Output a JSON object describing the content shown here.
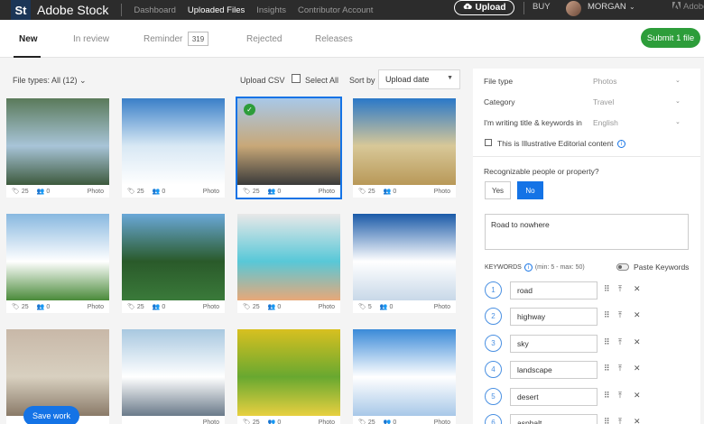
{
  "topbar": {
    "logo": "St",
    "brand": "Adobe Stock",
    "nav": [
      "Dashboard",
      "Uploaded Files",
      "Insights",
      "Contributor Account"
    ],
    "active_nav": "Uploaded Files",
    "upload_label": "Upload",
    "buy_label": "BUY",
    "username": "MORGAN",
    "adobe_label": "Adobe"
  },
  "tabs": {
    "items": [
      "New",
      "In review",
      "Reminder",
      "Rejected",
      "Releases"
    ],
    "reminder_count": "319",
    "submit_label": "Submit 1 file"
  },
  "filters": {
    "file_types": "File types: All (12)",
    "upload_csv": "Upload CSV",
    "select_all": "Select All",
    "sort_by": "Sort by",
    "sort_value": "Upload date"
  },
  "grid": [
    {
      "kw": "25",
      "people": "0",
      "type": "Photo",
      "colors": [
        "#5a7a5a",
        "#a8c4d8",
        "#3d5a3d"
      ],
      "selected": false
    },
    {
      "kw": "25",
      "people": "0",
      "type": "Photo",
      "colors": [
        "#3a7fc8",
        "#d8e8f4",
        "#ffffff"
      ],
      "selected": false
    },
    {
      "kw": "25",
      "people": "0",
      "type": "Photo",
      "colors": [
        "#a8c8e8",
        "#c8a878",
        "#3a3a3a"
      ],
      "selected": true
    },
    {
      "kw": "25",
      "people": "0",
      "type": "Photo",
      "colors": [
        "#2a78c8",
        "#d8c898",
        "#b89858"
      ],
      "selected": false
    },
    {
      "kw": "25",
      "people": "0",
      "type": "Photo",
      "colors": [
        "#88b8e0",
        "#ffffff",
        "#4a8a3a"
      ],
      "selected": false
    },
    {
      "kw": "25",
      "people": "0",
      "type": "Photo",
      "colors": [
        "#6aa8d8",
        "#2a5a2a",
        "#3a7a3a"
      ],
      "selected": false
    },
    {
      "kw": "25",
      "people": "0",
      "type": "Photo",
      "colors": [
        "#e8e8e8",
        "#58c8d8",
        "#e8a878"
      ],
      "selected": false
    },
    {
      "kw": "5",
      "people": "0",
      "type": "Photo",
      "colors": [
        "#1a5aa8",
        "#ffffff",
        "#c8d8e8"
      ],
      "selected": false
    },
    {
      "kw": "",
      "people": "",
      "type": "",
      "colors": [
        "#c8b8a8",
        "#d8d0c0",
        "#8a7a68"
      ],
      "selected": false
    },
    {
      "kw": "",
      "people": "",
      "type": "Photo",
      "colors": [
        "#a8c8e0",
        "#ffffff",
        "#6a7a8a"
      ],
      "selected": false
    },
    {
      "kw": "25",
      "people": "0",
      "type": "Photo",
      "colors": [
        "#d8c020",
        "#68a830",
        "#e8d040"
      ],
      "selected": false
    },
    {
      "kw": "25",
      "people": "0",
      "type": "Photo",
      "colors": [
        "#3a8ad8",
        "#ffffff",
        "#a8c8e8"
      ],
      "selected": false
    }
  ],
  "save_work": "Save work",
  "panel": {
    "file_type_label": "File type",
    "file_type_value": "Photos",
    "category_label": "Category",
    "category_value": "Travel",
    "language_label": "I'm writing title & keywords in",
    "language_value": "English",
    "editorial_label": "This is Illustrative Editorial content",
    "people_question": "Recognizable people or property?",
    "yes_label": "Yes",
    "no_label": "No",
    "title_value": "Road to nowhere",
    "keywords_label": "KEYWORDS",
    "keywords_range": "(min: 5 - max: 50)",
    "paste_keywords": "Paste Keywords",
    "keywords": [
      {
        "num": "1",
        "word": "road"
      },
      {
        "num": "2",
        "word": "highway"
      },
      {
        "num": "3",
        "word": "sky"
      },
      {
        "num": "4",
        "word": "landscape"
      },
      {
        "num": "5",
        "word": "desert"
      },
      {
        "num": "6",
        "word": "asphalt"
      }
    ]
  }
}
